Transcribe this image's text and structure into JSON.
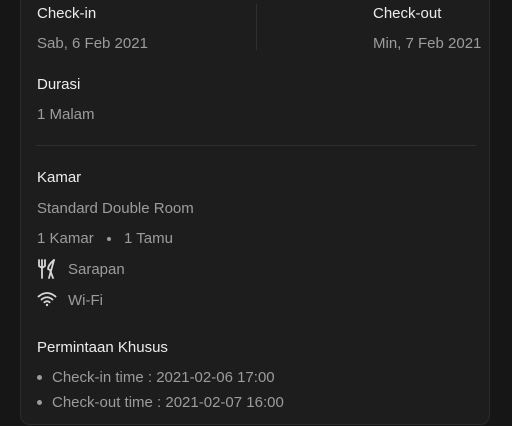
{
  "booking": {
    "checkin_label": "Check-in",
    "checkin_date": "Sab, 6 Feb 2021",
    "checkout_label": "Check-out",
    "checkout_date": "Min, 7 Feb 2021",
    "duration_label": "Durasi",
    "duration_value": "1 Malam"
  },
  "room": {
    "section_label": "Kamar",
    "room_type": "Standard Double Room",
    "room_count": "1 Kamar",
    "guest_count": "1 Tamu",
    "amenities": [
      {
        "icon": "cutlery-icon",
        "label": "Sarapan"
      },
      {
        "icon": "wifi-icon",
        "label": "Wi-Fi"
      }
    ]
  },
  "special_requests": {
    "section_label": "Permintaan Khusus",
    "items": [
      "Check-in time : 2021-02-06 17:00",
      "Check-out time : 2021-02-07 16:00"
    ]
  }
}
